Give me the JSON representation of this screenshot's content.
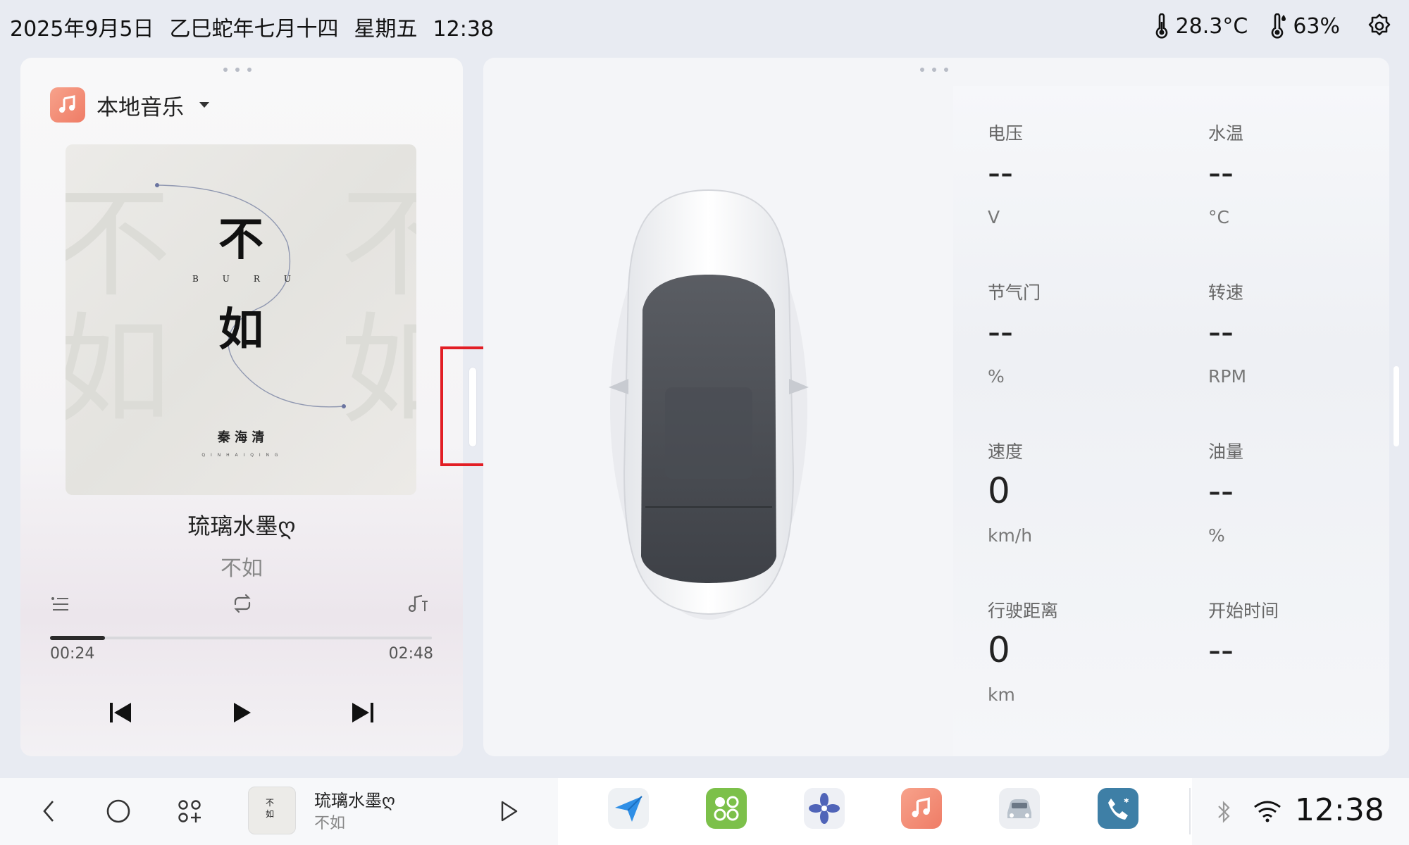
{
  "status_bar": {
    "date": "2025年9月5日",
    "lunar_date": "乙巳蛇年七月十四",
    "weekday": "星期五",
    "time": "12:38",
    "temperature": "28.3°C",
    "humidity": "63%",
    "icons": [
      "thermometer-icon",
      "humidity-icon",
      "settings-gear-icon"
    ]
  },
  "music": {
    "source_label": "本地音乐",
    "album_art": {
      "title_char_1": "不",
      "title_char_2": "如",
      "pinyin": [
        "B",
        "U",
        "R",
        "U"
      ],
      "artist": "秦 海 清",
      "artist_pinyin": "Q I N H A I Q I N G"
    },
    "song_title": "琉璃水墨ღ",
    "artist": "不如",
    "current_time": "00:24",
    "total_time": "02:48",
    "progress": 0.143,
    "controls": [
      "playlist-icon",
      "repeat-icon",
      "lyrics-icon",
      "previous-icon",
      "play-icon",
      "next-icon"
    ]
  },
  "vehicle": {
    "metrics": [
      {
        "label": "电压",
        "value": "--",
        "unit": "V"
      },
      {
        "label": "水温",
        "value": "--",
        "unit": "°C"
      },
      {
        "label": "节气门",
        "value": "--",
        "unit": "%"
      },
      {
        "label": "转速",
        "value": "--",
        "unit": "RPM"
      },
      {
        "label": "速度",
        "value": "0",
        "unit": "km/h"
      },
      {
        "label": "油量",
        "value": "--",
        "unit": "%"
      },
      {
        "label": "行驶距离",
        "value": "0",
        "unit": "km"
      },
      {
        "label": "开始时间",
        "value": "--",
        "unit": ""
      }
    ]
  },
  "dock": {
    "mini_player": {
      "title": "琉璃水墨ღ",
      "artist": "不如"
    },
    "apps": [
      "navigation-app-icon",
      "apps-grid-app-icon",
      "fan-app-icon",
      "music-app-icon",
      "car-app-icon",
      "phone-app-icon"
    ],
    "clock": "12:38",
    "colors": {
      "music": "#f08a72",
      "apps": "#7cc04a",
      "phone": "#3e7fa6"
    }
  }
}
